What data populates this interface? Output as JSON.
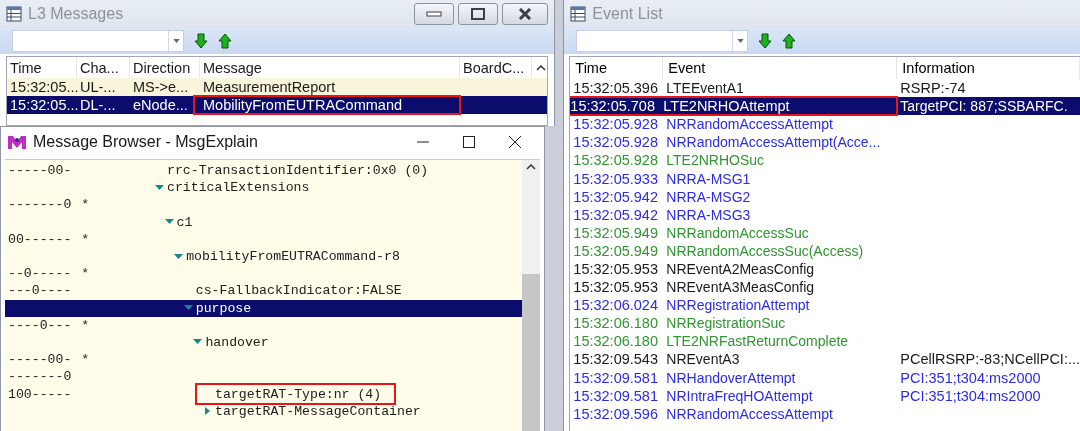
{
  "l3_messages": {
    "title": "L3 Messages",
    "columns": [
      "Time",
      "Cha...",
      "Direction",
      "Message",
      "BoardC..."
    ],
    "rows": [
      {
        "time": "15:32:05...",
        "channel": "UL-...",
        "direction": "MS->e...",
        "message": "MeasurementReport",
        "selected": false,
        "highlighted": false
      },
      {
        "time": "15:32:05...",
        "channel": "DL-...",
        "direction": "eNode...",
        "message": "MobilityFromEUTRACommand",
        "selected": true,
        "highlighted": true
      }
    ]
  },
  "message_browser": {
    "title": "Message Browser - MsgExplain",
    "tree": [
      {
        "bits": "-----00-",
        "label": "rrc-TransactionIdentifier:0x0 (0)",
        "selected": false,
        "highlighted": false
      },
      {
        "label": "criticalExtensions",
        "expanded": true,
        "selected": false,
        "highlighted": false,
        "children": [
          {
            "bits": "-------0",
            "marker": "*",
            "selected": false,
            "highlighted": false
          },
          {
            "label": "c1",
            "expanded": true,
            "selected": false,
            "highlighted": false,
            "children": [
              {
                "bits": "00------",
                "marker": "*",
                "selected": false,
                "highlighted": false
              },
              {
                "label": "mobilityFromEUTRACommand-r8",
                "expanded": true,
                "selected": false,
                "highlighted": false,
                "children": [
                  {
                    "bits": "--0-----",
                    "marker": "*",
                    "selected": false,
                    "highlighted": false
                  },
                  {
                    "bits": "---0----",
                    "label": "cs-FallbackIndicator:FALSE",
                    "selected": false,
                    "highlighted": false
                  },
                  {
                    "label": "purpose",
                    "expanded": true,
                    "selected": true,
                    "highlighted": false,
                    "children": [
                      {
                        "bits": "----0---",
                        "marker": "*",
                        "selected": false,
                        "highlighted": false
                      },
                      {
                        "label": "handover",
                        "expanded": true,
                        "selected": false,
                        "highlighted": false,
                        "children": [
                          {
                            "bits": "-----00-",
                            "marker": "*",
                            "selected": false,
                            "highlighted": false
                          },
                          {
                            "bits": "-------0",
                            "selected": false,
                            "highlighted": false
                          },
                          {
                            "bits": "100-----",
                            "label": "targetRAT-Type:nr (4)",
                            "selected": false,
                            "highlighted": true
                          },
                          {
                            "label": "targetRAT-MessageContainer",
                            "expanded": false,
                            "selected": false,
                            "highlighted": false
                          }
                        ]
                      }
                    ]
                  }
                ]
              }
            ]
          }
        ]
      }
    ]
  },
  "event_list": {
    "title": "Event List",
    "columns": [
      "Time",
      "Event",
      "Information"
    ],
    "rows": [
      {
        "time": "15:32:05.396",
        "event": "LTEEventA1",
        "information": "RSRP:-74",
        "color": "#1a1a1a",
        "selected": false,
        "highlighted": false
      },
      {
        "time": "15:32:05.708",
        "event": "LTE2NRHOAttempt",
        "information": "TargetPCI: 887;SSBARFC.",
        "selected": true,
        "highlighted": true
      },
      {
        "time": "15:32:05.928",
        "event": "NRRandomAccessAttempt",
        "color": "#2b2bec",
        "selected": false,
        "highlighted": false
      },
      {
        "time": "15:32:05.928",
        "event": "NRRandomAccessAttempt(Acce...",
        "color": "#2b2bec",
        "selected": false,
        "highlighted": false
      },
      {
        "time": "15:32:05.928",
        "event": "LTE2NRHOSuc",
        "color": "#2f962f",
        "selected": false,
        "highlighted": false
      },
      {
        "time": "15:32:05.933",
        "event": "NRRA-MSG1",
        "color": "#2b2bec",
        "selected": false,
        "highlighted": false
      },
      {
        "time": "15:32:05.942",
        "event": "NRRA-MSG2",
        "color": "#2b2bec",
        "selected": false,
        "highlighted": false
      },
      {
        "time": "15:32:05.942",
        "event": "NRRA-MSG3",
        "color": "#2b2bec",
        "selected": false,
        "highlighted": false
      },
      {
        "time": "15:32:05.949",
        "event": "NRRandomAccessSuc",
        "color": "#2f962f",
        "selected": false,
        "highlighted": false
      },
      {
        "time": "15:32:05.949",
        "event": "NRRandomAccessSuc(Access)",
        "color": "#2f962f",
        "selected": false,
        "highlighted": false
      },
      {
        "time": "15:32:05.953",
        "event": "NREventA2MeasConfig",
        "color": "#1a1a1a",
        "selected": false,
        "highlighted": false
      },
      {
        "time": "15:32:05.953",
        "event": "NREventA3MeasConfig",
        "color": "#1a1a1a",
        "selected": false,
        "highlighted": false
      },
      {
        "time": "15:32:06.024",
        "event": "NRRegistrationAttempt",
        "color": "#2b2bec",
        "selected": false,
        "highlighted": false
      },
      {
        "time": "15:32:06.180",
        "event": "NRRegistrationSuc",
        "color": "#2f962f",
        "selected": false,
        "highlighted": false
      },
      {
        "time": "15:32:06.180",
        "event": "LTE2NRFastReturnComplete",
        "color": "#2f962f",
        "selected": false,
        "highlighted": false
      },
      {
        "time": "15:32:09.543",
        "event": "NREventA3",
        "information": "PCellRSRP:-83;NCellPCI:...",
        "color": "#1a1a1a",
        "selected": false,
        "highlighted": false
      },
      {
        "time": "15:32:09.581",
        "event": "NRHandoverAttempt",
        "information": "PCI:351;t304:ms2000",
        "color": "#2b2bec",
        "selected": false,
        "highlighted": false
      },
      {
        "time": "15:32:09.581",
        "event": "NRIntraFreqHOAttempt",
        "information": "PCI:351;t304:ms2000",
        "color": "#2b2bec",
        "selected": false,
        "highlighted": false
      },
      {
        "time": "15:32:09.596",
        "event": "NRRandomAccessAttempt",
        "color": "#2b2bec",
        "selected": false,
        "highlighted": false
      }
    ]
  }
}
